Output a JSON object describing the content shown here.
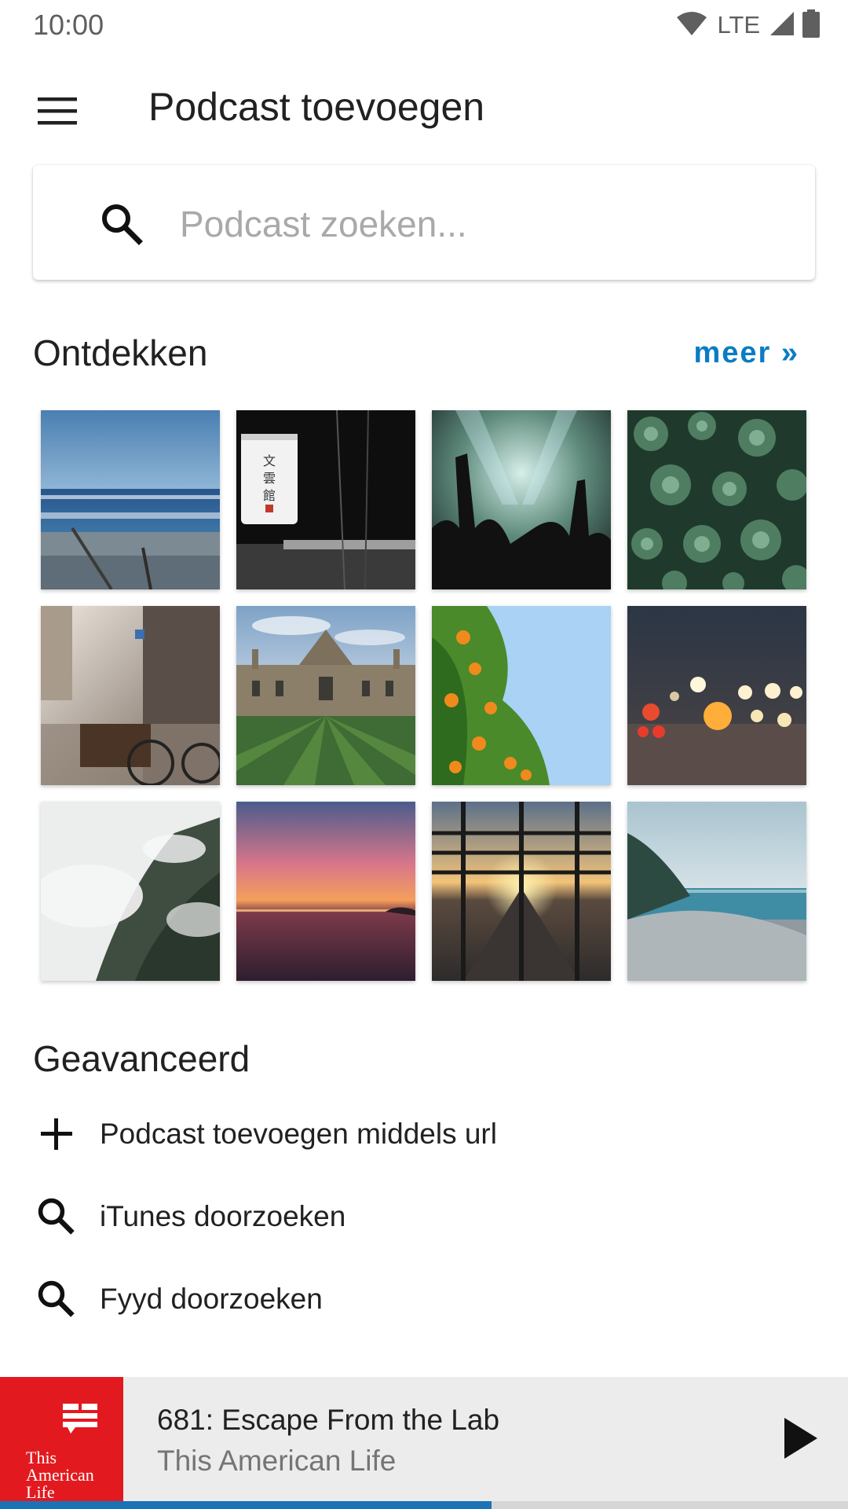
{
  "status_bar": {
    "time": "10:00",
    "network": "LTE",
    "icons": [
      "wifi-icon",
      "signal-icon",
      "battery-icon"
    ]
  },
  "appbar": {
    "title": "Podcast toevoegen",
    "menu_icon": "menu-icon"
  },
  "search": {
    "placeholder": "Podcast zoeken...",
    "value": "",
    "icon": "search-icon"
  },
  "discover": {
    "title": "Ontdekken",
    "more_label": "meer »",
    "tiles": [
      {
        "name": "beach-waves"
      },
      {
        "name": "paper-lantern"
      },
      {
        "name": "concert-crowd"
      },
      {
        "name": "succulents"
      },
      {
        "name": "street-bicycles"
      },
      {
        "name": "college-building"
      },
      {
        "name": "orange-tree"
      },
      {
        "name": "bokeh-lights"
      },
      {
        "name": "misty-mountain"
      },
      {
        "name": "sunset-sea"
      },
      {
        "name": "highway-sunset"
      },
      {
        "name": "rocky-shore"
      }
    ]
  },
  "advanced": {
    "title": "Geavanceerd",
    "items": [
      {
        "label": "Podcast toevoegen middels url",
        "icon": "plus-icon"
      },
      {
        "label": "iTunes doorzoeken",
        "icon": "search-icon"
      },
      {
        "label": "Fyyd doorzoeken",
        "icon": "search-icon"
      }
    ]
  },
  "player": {
    "episode_title": "681: Escape From the Lab",
    "podcast_title": "This American Life",
    "art_text_lines": [
      "This",
      "American",
      "Life"
    ],
    "progress": 0.58,
    "play_icon": "play-icon"
  },
  "colors": {
    "accent": "#0a7cc4",
    "player_bg": "#ececec",
    "art_red": "#e21a1f",
    "progress": "#1a73b7"
  }
}
